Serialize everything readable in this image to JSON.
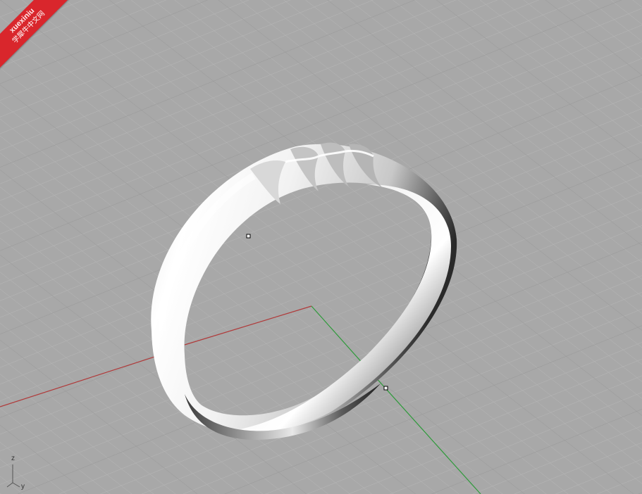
{
  "watermark": {
    "brand": "xuexiniu",
    "site": "学犀牛中文网"
  },
  "axis_widget": {
    "z_label": "z",
    "y_label": "y"
  },
  "colors": {
    "background": "#a8a8a8",
    "grid_minor": "#b3b3b3",
    "grid_major": "#9a9a9a",
    "x_axis": "#b03a3a",
    "y_axis": "#2e9a3a",
    "watermark_red": "#d9262c"
  },
  "scene": {
    "object": "ring",
    "selection_handles": 2
  }
}
